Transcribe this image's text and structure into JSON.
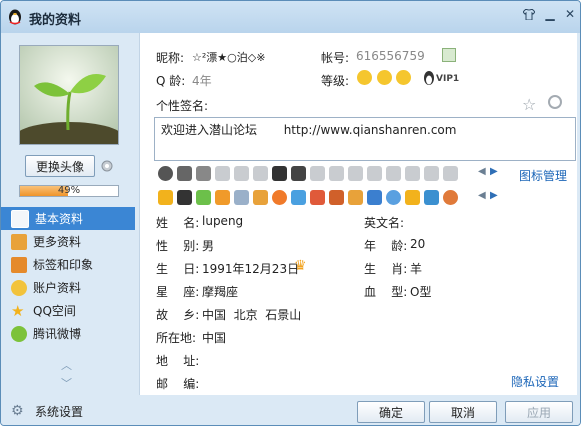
{
  "window": {
    "title": "我的资料"
  },
  "left": {
    "change_avatar_label": "更换头像",
    "progress_percent": 49,
    "progress_label": "49%",
    "nav": [
      {
        "label": "基本资料",
        "icon": "profile-card-icon",
        "active": true
      },
      {
        "label": "更多资料",
        "icon": "more-info-icon",
        "active": false
      },
      {
        "label": "标签和印象",
        "icon": "tag-icon",
        "active": false
      },
      {
        "label": "账户资料",
        "icon": "account-icon",
        "active": false
      },
      {
        "label": "QQ空间",
        "icon": "qzone-star-icon",
        "active": false
      },
      {
        "label": "腾讯微博",
        "icon": "weibo-icon",
        "active": false
      }
    ]
  },
  "profile": {
    "nickname_label": "昵称:",
    "nickname": "☆²漂★○泊◇※",
    "account_label": "帐号:",
    "account": "616556759",
    "age_label": "Q 龄:",
    "age": "4年",
    "level_label": "等级:",
    "vip": "VIP1",
    "signature_label": "个性签名:",
    "signature": "欢迎进入潜山论坛       http://www.qianshanren.com",
    "badge_manage": "图标管理"
  },
  "details": {
    "name_label": "姓    名:",
    "name": "lupeng",
    "english_name_label": "英文名:",
    "english_name": "",
    "gender_label": "性    别:",
    "gender": "男",
    "age_label": "年    龄:",
    "age": "20",
    "birthday_label": "生    日:",
    "birthday": "1991年12月23日",
    "zodiac_label": "生    肖:",
    "zodiac": "羊",
    "constellation_label": "星    座:",
    "constellation": "摩羯座",
    "blood_label": "血    型:",
    "blood": "O型",
    "hometown_label": "故    乡:",
    "hometown": "中国  北京  石景山",
    "location_label": "所在地:",
    "location": "中国",
    "address_label": "地    址:",
    "address": "",
    "zip_label": "邮    编:",
    "zip": "",
    "privacy_link": "隐私设置"
  },
  "bottom": {
    "settings_label": "系统设置",
    "ok_label": "确定",
    "cancel_label": "取消",
    "apply_label": "应用"
  },
  "colors": {
    "accent": "#3b86d4",
    "link": "#1c66b8",
    "window_bg": "#dbe9f5",
    "progress": "#f0942a"
  }
}
